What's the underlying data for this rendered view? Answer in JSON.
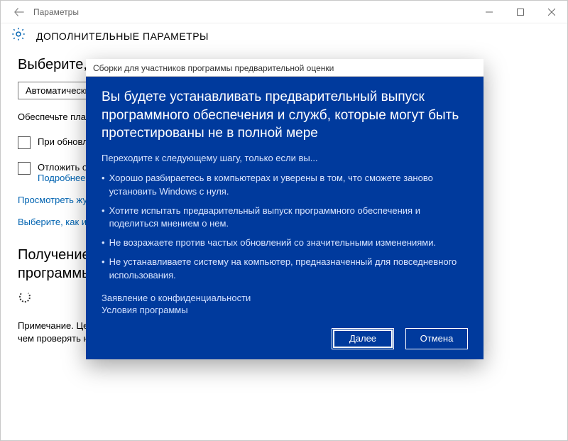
{
  "titlebar": {
    "app_name": "Параметры"
  },
  "header": {
    "title": "ДОПОЛНИТЕЛЬНЫЕ ПАРАМЕТРЫ"
  },
  "page": {
    "section1": "Выберите,",
    "dropdown_value": "Автоматически",
    "para1": "Обеспечьте плав будет выполнена обновлений не б подключение (ко",
    "checkbox1": "При обновл других проду",
    "checkbox2": "Отложить об",
    "more_link": "Подробнее",
    "link_view_log": "Просмотреть жу",
    "link_choose_how": "Выберите, как и",
    "section2_line1": "Получение",
    "section2_line2": "программы предварительной оценки",
    "note": "Примечание. Центр обновления Windows может автоматически обновляться, прежде чем проверять наличие обновлений для"
  },
  "modal": {
    "caption": "Сборки для участников программы предварительной оценки",
    "heading": "Вы будете устанавливать предварительный выпуск программного обеспечения и служб, которые могут быть протестированы не в полной мере",
    "lead": "Переходите к следующему шагу, только если вы...",
    "bullets": [
      "Хорошо разбираетесь в компьютерах и уверены в том, что сможете заново установить Windows с нуля.",
      "Хотите испытать предварительный выпуск программного обеспечения и поделиться мнением о нем.",
      "Не возражаете против частых обновлений со значительными изменениями.",
      "Не устанавливаете систему на компьютер, предназначенный для повседневного использования."
    ],
    "privacy_link": "Заявление о конфиденциальности",
    "terms_link": "Условия программы",
    "btn_next": "Далее",
    "btn_cancel": "Отмена"
  }
}
